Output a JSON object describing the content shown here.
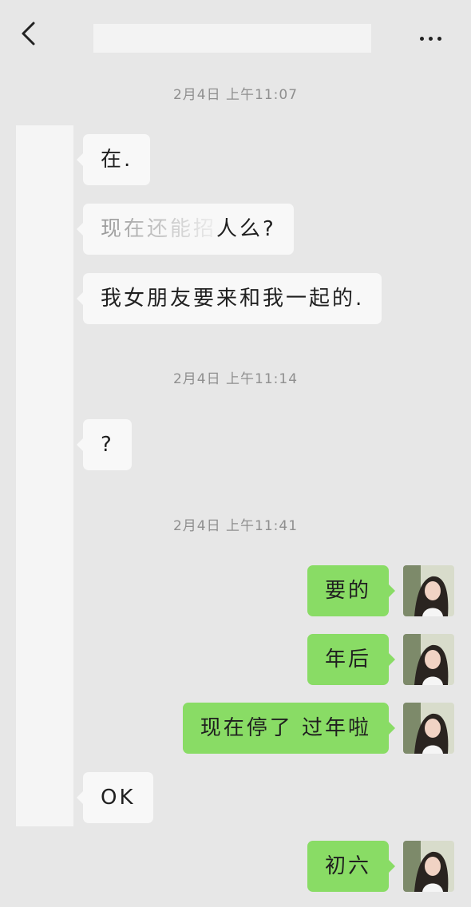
{
  "messages": [
    {
      "type": "timestamp",
      "text": "2月4日 上午11:07"
    },
    {
      "type": "message",
      "side": "left",
      "text": "在."
    },
    {
      "type": "message",
      "side": "left",
      "text": "现在还能招人么?"
    },
    {
      "type": "message",
      "side": "left",
      "text": "我女朋友要来和我一起的."
    },
    {
      "type": "timestamp",
      "text": "2月4日 上午11:14"
    },
    {
      "type": "message",
      "side": "left",
      "text": "?"
    },
    {
      "type": "timestamp",
      "text": "2月4日 上午11:41"
    },
    {
      "type": "message",
      "side": "right",
      "text": "要的"
    },
    {
      "type": "message",
      "side": "right",
      "text": "年后"
    },
    {
      "type": "message",
      "side": "right",
      "text": "现在停了 过年啦"
    },
    {
      "type": "message",
      "side": "left",
      "text": "OK"
    },
    {
      "type": "message",
      "side": "right",
      "text": "初六"
    }
  ],
  "colors": {
    "background": "#e7e7e7",
    "incoming_bubble": "#f8f8f8",
    "outgoing_bubble": "#89dc65",
    "timestamp_text": "#8f8f8f"
  },
  "icons": {
    "back": "back-arrow-icon",
    "more": "more-dots-icon",
    "avatar": "contact-avatar"
  }
}
